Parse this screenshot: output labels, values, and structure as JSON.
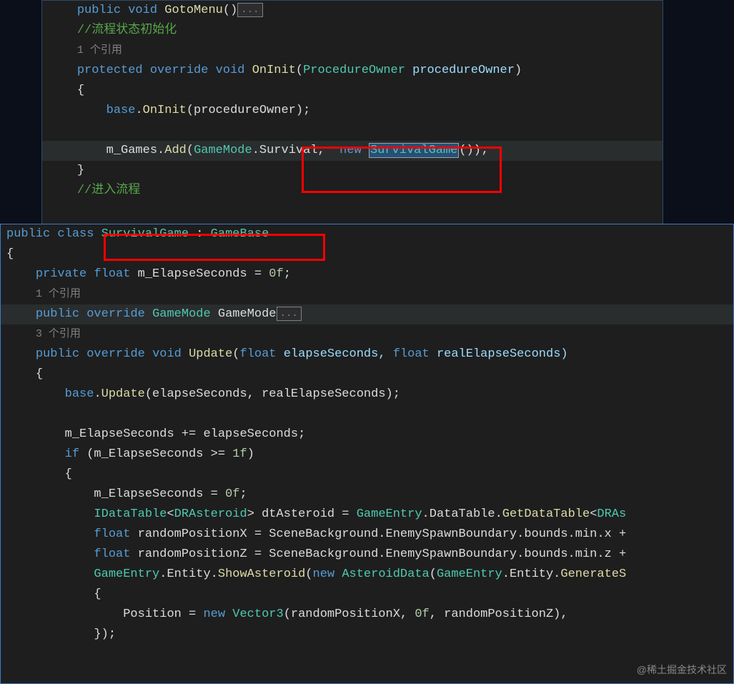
{
  "top": {
    "l1_kw1": "public",
    "l1_kw2": "void",
    "l1_method": "GotoMenu",
    "l1_p": "()",
    "collapsed": "...",
    "l2_comment": "//流程状态初始化",
    "l3_codelens": "1 个引用",
    "l4_kw1": "protected",
    "l4_kw2": "override",
    "l4_kw3": "void",
    "l4_method": "OnInit",
    "l4_p1": "(",
    "l4_type": "ProcedureOwner",
    "l4_param": " procedureOwner",
    "l4_p2": ")",
    "l5": "{",
    "l6_base": "base",
    "l6_dot": ".",
    "l6_method": "OnInit",
    "l6_p": "(procedureOwner);",
    "l8_obj": "m_Games",
    "l8_dot1": ".",
    "l8_add": "Add",
    "l8_p1": "(",
    "l8_gm": "GameMode",
    "l8_dot2": ".",
    "l8_surv": "Survival",
    "l8_comma": ", ",
    "l8_new": "new",
    "l8_sp": " ",
    "l8_sg": "SurvivalGame",
    "l8_p2": "());",
    "l9": "}",
    "l10_comment": "//进入流程"
  },
  "bottom": {
    "l1_kw1": "public",
    "l1_kw2": "class",
    "l1_name": "SurvivalGame",
    "l1_colon": " : ",
    "l1_base": "GameBase",
    "l2": "{",
    "l3_kw1": "private",
    "l3_kw2": "float",
    "l3_name": " m_ElapseSeconds = ",
    "l3_val": "0f",
    "l3_semi": ";",
    "l4_codelens": "1 个引用",
    "l5_kw1": "public",
    "l5_kw2": "override",
    "l5_type": "GameMode",
    "l5_name": " GameMode",
    "collapsed": "...",
    "l6_codelens": "3 个引用",
    "l7_kw1": "public",
    "l7_kw2": "override",
    "l7_kw3": "void",
    "l7_method": "Update",
    "l7_p1": "(",
    "l7_t1": "float",
    "l7_a1": " elapseSeconds, ",
    "l7_t2": "float",
    "l7_a2": " realElapseSeconds)",
    "l8": "{",
    "l9_base": "base",
    "l9_dot": ".",
    "l9_method": "Update",
    "l9_p": "(elapseSeconds, realElapseSeconds);",
    "l11_a": "m_ElapseSeconds += elapseSeconds;",
    "l12_if": "if",
    "l12_p": " (m_ElapseSeconds >= ",
    "l12_n": "1f",
    "l12_p2": ")",
    "l13": "{",
    "l14_a": "m_ElapseSeconds = ",
    "l14_n": "0f",
    "l14_s": ";",
    "l15_t1": "IDataTable",
    "l15_lt": "<",
    "l15_t2": "DRAsteroid",
    "l15_gt": ">",
    "l15_v": " dtAsteroid = ",
    "l15_t3": "GameEntry",
    "l15_r": ".DataTable.",
    "l15_m": "GetDataTable",
    "l15_lt2": "<",
    "l15_t4": "DRAs",
    "l16_kw": "float",
    "l16_v": " randomPositionX = SceneBackground.EnemySpawnBoundary.bounds.min.x +",
    "l17_kw": "float",
    "l17_v": " randomPositionZ = SceneBackground.EnemySpawnBoundary.bounds.min.z +",
    "l18_t": "GameEntry",
    "l18_a": ".Entity.",
    "l18_m": "ShowAsteroid",
    "l18_p1": "(",
    "l18_new": "new",
    "l18_sp": " ",
    "l18_t2": "AsteroidData",
    "l18_p2": "(",
    "l18_t3": "GameEntry",
    "l18_r": ".Entity.",
    "l18_m2": "GenerateS",
    "l19": "{",
    "l20_prop": "Position = ",
    "l20_new": "new",
    "l20_sp": " ",
    "l20_t": "Vector3",
    "l20_p": "(randomPositionX, ",
    "l20_n": "0f",
    "l20_p2": ", randomPositionZ),",
    "l21": "});"
  },
  "watermark": "@稀土掘金技术社区"
}
